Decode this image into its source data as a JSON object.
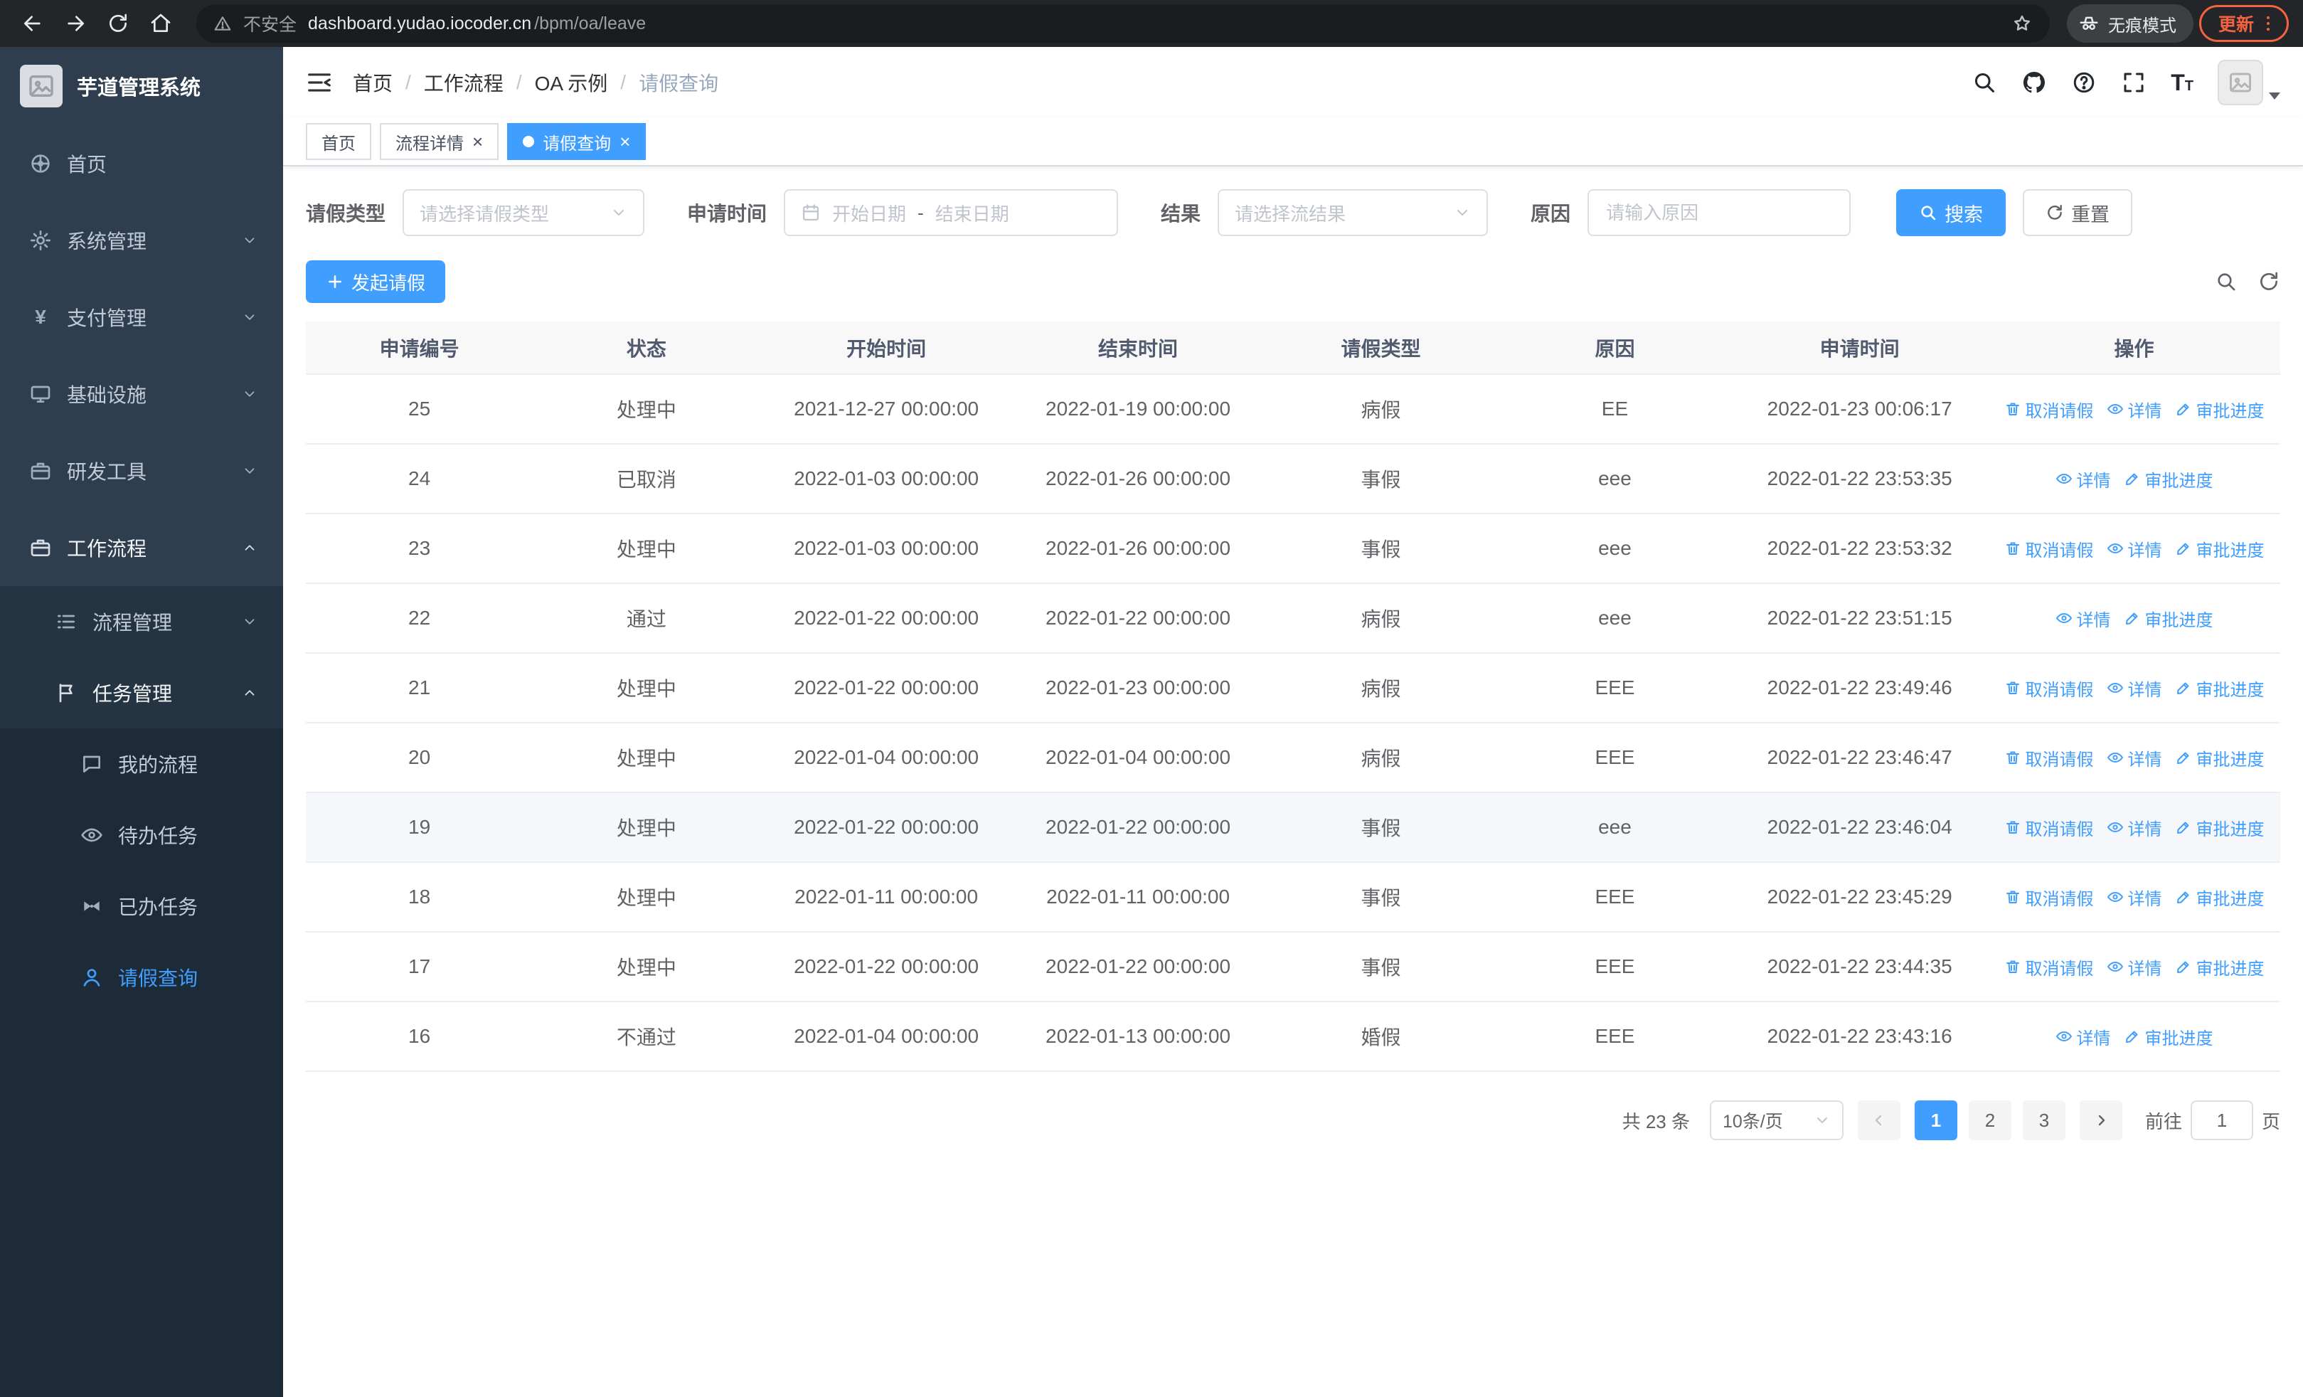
{
  "colors": {
    "primary": "#409eff",
    "sidebar_base": "#2f3e4e",
    "sidebar_nested": "#1d2b39",
    "update_accent": "#f4633f"
  },
  "browser": {
    "security_warning": "不安全",
    "url_host": "dashboard.yudao.iocoder.cn",
    "url_path": "/bpm/oa/leave",
    "incognito_label": "无痕模式",
    "update_label": "更新"
  },
  "sidebar": {
    "logo_title": "芋道管理系统",
    "items": [
      {
        "key": "home",
        "label": "首页",
        "icon": "dashboard",
        "level": 1
      },
      {
        "key": "system-mgmt",
        "label": "系统管理",
        "icon": "gear",
        "level": 1,
        "arrow": "down"
      },
      {
        "key": "payment-mgmt",
        "label": "支付管理",
        "icon": "yen",
        "level": 1,
        "arrow": "down"
      },
      {
        "key": "infrastructure",
        "label": "基础设施",
        "icon": "monitor",
        "level": 1,
        "arrow": "down"
      },
      {
        "key": "dev-tools",
        "label": "研发工具",
        "icon": "briefcase",
        "level": 1,
        "arrow": "down"
      },
      {
        "key": "workflow",
        "label": "工作流程",
        "icon": "briefcase",
        "level": 1,
        "arrow": "up",
        "emphasis": true
      },
      {
        "key": "process-mgmt",
        "label": "流程管理",
        "icon": "list",
        "level": 2,
        "arrow": "down"
      },
      {
        "key": "task-mgmt",
        "label": "任务管理",
        "icon": "flag",
        "level": 2,
        "arrow": "up",
        "emphasis": true
      },
      {
        "key": "my-processes",
        "label": "我的流程",
        "icon": "chat",
        "level": 3
      },
      {
        "key": "todo-tasks",
        "label": "待办任务",
        "icon": "eye",
        "level": 3
      },
      {
        "key": "done-tasks",
        "label": "已办任务",
        "icon": "bowtie",
        "level": 3
      },
      {
        "key": "leave-query",
        "label": "请假查询",
        "icon": "user",
        "level": 3,
        "active": true
      }
    ]
  },
  "header": {
    "breadcrumbs": [
      "首页",
      "工作流程",
      "OA 示例",
      "请假查询"
    ]
  },
  "tabs": [
    {
      "label": "首页",
      "closable": false,
      "active": false
    },
    {
      "label": "流程详情",
      "closable": true,
      "active": false
    },
    {
      "label": "请假查询",
      "closable": true,
      "active": true
    }
  ],
  "filters": {
    "leave_type_label": "请假类型",
    "leave_type_placeholder": "请选择请假类型",
    "apply_time_label": "申请时间",
    "start_date_placeholder": "开始日期",
    "range_separator": "-",
    "end_date_placeholder": "结束日期",
    "result_label": "结果",
    "result_placeholder": "请选择流结果",
    "reason_label": "原因",
    "reason_placeholder": "请输入原因",
    "search_label": "搜索",
    "reset_label": "重置"
  },
  "toolbar": {
    "create_label": "发起请假"
  },
  "table": {
    "columns": [
      "申请编号",
      "状态",
      "开始时间",
      "结束时间",
      "请假类型",
      "原因",
      "申请时间",
      "操作"
    ],
    "column_keys": [
      "id",
      "status",
      "start-time",
      "end-time",
      "leave-type",
      "reason",
      "apply-time"
    ],
    "actions": {
      "cancel": "取消请假",
      "detail": "详情",
      "progress": "审批进度"
    },
    "rows": [
      {
        "id": "25",
        "status": "处理中",
        "start": "2021-12-27 00:00:00",
        "end": "2022-01-19 00:00:00",
        "type": "病假",
        "reason": "EE",
        "applied": "2022-01-23 00:06:17",
        "can_cancel": true
      },
      {
        "id": "24",
        "status": "已取消",
        "start": "2022-01-03 00:00:00",
        "end": "2022-01-26 00:00:00",
        "type": "事假",
        "reason": "eee",
        "applied": "2022-01-22 23:53:35",
        "can_cancel": false
      },
      {
        "id": "23",
        "status": "处理中",
        "start": "2022-01-03 00:00:00",
        "end": "2022-01-26 00:00:00",
        "type": "事假",
        "reason": "eee",
        "applied": "2022-01-22 23:53:32",
        "can_cancel": true
      },
      {
        "id": "22",
        "status": "通过",
        "start": "2022-01-22 00:00:00",
        "end": "2022-01-22 00:00:00",
        "type": "病假",
        "reason": "eee",
        "applied": "2022-01-22 23:51:15",
        "can_cancel": false
      },
      {
        "id": "21",
        "status": "处理中",
        "start": "2022-01-22 00:00:00",
        "end": "2022-01-23 00:00:00",
        "type": "病假",
        "reason": "EEE",
        "applied": "2022-01-22 23:49:46",
        "can_cancel": true
      },
      {
        "id": "20",
        "status": "处理中",
        "start": "2022-01-04 00:00:00",
        "end": "2022-01-04 00:00:00",
        "type": "病假",
        "reason": "EEE",
        "applied": "2022-01-22 23:46:47",
        "can_cancel": true
      },
      {
        "id": "19",
        "status": "处理中",
        "start": "2022-01-22 00:00:00",
        "end": "2022-01-22 00:00:00",
        "type": "事假",
        "reason": "eee",
        "applied": "2022-01-22 23:46:04",
        "can_cancel": true,
        "highlighted": true
      },
      {
        "id": "18",
        "status": "处理中",
        "start": "2022-01-11 00:00:00",
        "end": "2022-01-11 00:00:00",
        "type": "事假",
        "reason": "EEE",
        "applied": "2022-01-22 23:45:29",
        "can_cancel": true
      },
      {
        "id": "17",
        "status": "处理中",
        "start": "2022-01-22 00:00:00",
        "end": "2022-01-22 00:00:00",
        "type": "事假",
        "reason": "EEE",
        "applied": "2022-01-22 23:44:35",
        "can_cancel": true
      },
      {
        "id": "16",
        "status": "不通过",
        "start": "2022-01-04 00:00:00",
        "end": "2022-01-13 00:00:00",
        "type": "婚假",
        "reason": "EEE",
        "applied": "2022-01-22 23:43:16",
        "can_cancel": false
      }
    ]
  },
  "pagination": {
    "total_text": "共 23 条",
    "page_size": "10条/页",
    "pages": [
      "1",
      "2",
      "3"
    ],
    "active_page": "1",
    "goto_label": "前往",
    "goto_value": "1",
    "goto_suffix": "页"
  }
}
